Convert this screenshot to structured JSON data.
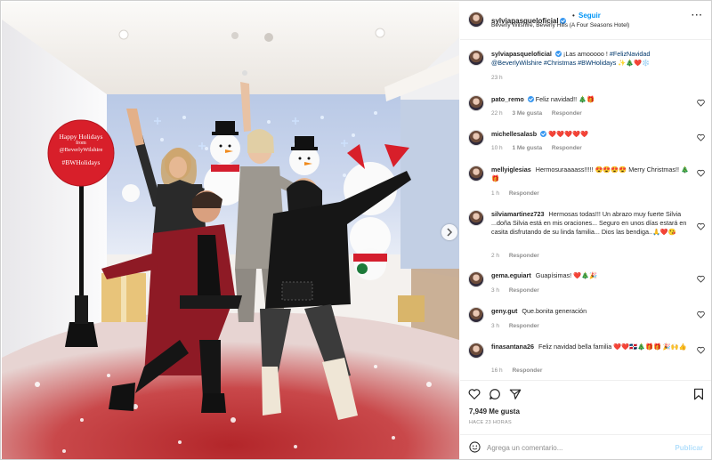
{
  "post": {
    "author": "sylviapasqueloficial",
    "verified": true,
    "follow_label": "Seguir",
    "separator": "•",
    "location": "Beverly Wilshire, Beverly Hills (A Four Seasons Hotel)",
    "more_label": "···",
    "caption": {
      "user": "sylviapasqueloficial",
      "text_plain": "¡Las amooooo ! ",
      "hashtags_1": "#FelizNavidad",
      "mention": "@BeverlyWilshire",
      "hashtags_2": "#Christmas #BWHolidays",
      "emoji": "✨🎄❤️❄️",
      "time": "23 h"
    },
    "sign": {
      "line1": "Happy Holidays",
      "line2": "from",
      "line3": "@BeverlyWilshire",
      "line4": "#BWHolidays"
    },
    "likes": "7,949 Me gusta",
    "posted": "HACE 23 HORAS",
    "comment_placeholder": "Agrega un comentario...",
    "publish_label": "Publicar"
  },
  "comments": [
    {
      "user": "pato_remo",
      "verified": true,
      "text": "Feliz navidad!! 🎄🎁",
      "time": "22 h",
      "likes": "3 Me gusta",
      "reply": "Responder"
    },
    {
      "user": "michellesalasb",
      "verified": true,
      "text": "❤️❤️❤️❤️❤️",
      "time": "10 h",
      "likes": "1 Me gusta",
      "reply": "Responder"
    },
    {
      "user": "mellyiglesias",
      "verified": false,
      "text": "Hermosuraaaass!!!!! 😍😍😍😍 Merry Christmas!! 🎄🎁",
      "time": "1 h",
      "likes": "",
      "reply": "Responder"
    },
    {
      "user": "silviamartinez723",
      "verified": false,
      "text": "Hermosas todas!!! Un abrazo muy fuerte Silvia ...doña Silvia está en mis oraciones... Seguro en unos días estará en casita disfrutando de su linda familia... Dios las bendiga..🙏❤️😘",
      "time": "2 h",
      "likes": "",
      "reply": "Responder"
    },
    {
      "user": "gema.eguiart",
      "verified": false,
      "text": "Guapísimas! ❤️🎄🎉",
      "time": "3 h",
      "likes": "",
      "reply": "Responder"
    },
    {
      "user": "geny.gut",
      "verified": false,
      "text": "Que.bonita generación",
      "time": "3 h",
      "likes": "",
      "reply": "Responder"
    },
    {
      "user": "finasantana26",
      "verified": false,
      "text": "Feliz navidad bella familia ❤️❤️🇩🇴🎄🎁🎁 🎉🙌👍",
      "time": "16 h",
      "likes": "",
      "reply": "Responder"
    }
  ],
  "colors": {
    "accent": "#0095f6",
    "publish_disabled": "#b2dffc",
    "hashtag": "#00376b",
    "muted": "#8e8e8e",
    "sign_red": "#d81f2a"
  },
  "icons": [
    "heart-icon",
    "comment-icon",
    "share-icon",
    "bookmark-icon",
    "emoji-icon",
    "more-icon",
    "chevron-right-icon"
  ]
}
